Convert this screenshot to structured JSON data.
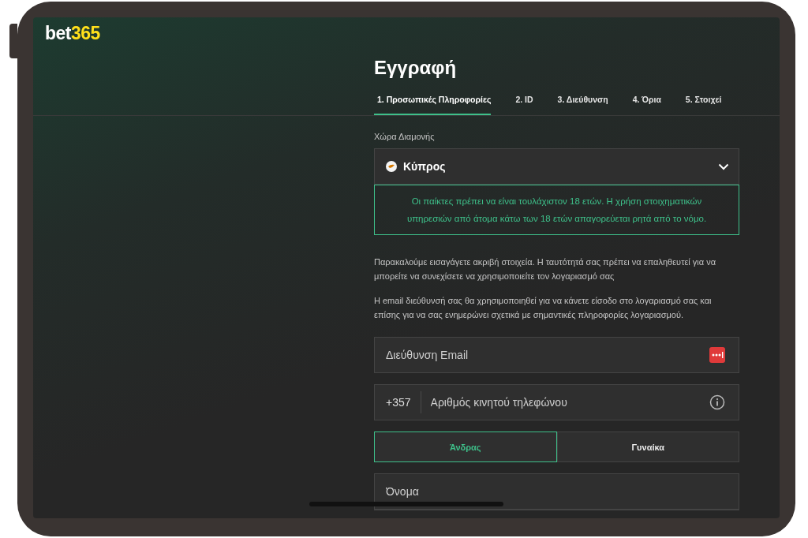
{
  "logo": {
    "part_1": "bet",
    "part_2": "365"
  },
  "title": "Εγγραφή",
  "tabs": [
    {
      "label": "1. Προσωπικές Πληροφορίες",
      "selected": true
    },
    {
      "label": "2. ID",
      "selected": false
    },
    {
      "label": "3. Διεύθυνση",
      "selected": false
    },
    {
      "label": "4. Όρια",
      "selected": false
    },
    {
      "label": "5. Στοιχεί",
      "selected": false
    }
  ],
  "country": {
    "label": "Χώρα Διαμονής",
    "value": "Κύπρος"
  },
  "notice": "Οι παίκτες πρέπει να είναι τουλάχιστον 18 ετών. Η χρήση στοιχηματικών υπηρεσιών από άτομα κάτω των 18 ετών απαγορεύεται ρητά από το νόμο.",
  "paragraphs": [
    "Παρακαλούμε εισαγάγετε ακριβή στοιχεία. Η ταυτότητά σας πρέπει να επαληθευτεί για να μπορείτε να συνεχίσετε να χρησιμοποιείτε τον λογαριασμό σας",
    "Η email διεύθυνσή σας θα χρησιμοποιηθεί για να κάνετε είσοδο στο λογαριασμό σας και επίσης για να σας ενημερώνει σχετικά με σημαντικές πληροφορίες λογαριασμού."
  ],
  "email": {
    "placeholder": "Διεύθυνση Email"
  },
  "phone": {
    "prefix": "+357",
    "placeholder": "Αριθμός κινητού τηλεφώνου"
  },
  "gender": [
    {
      "label": "Άνδρας",
      "selected": true
    },
    {
      "label": "Γυναίκα",
      "selected": false
    }
  ],
  "first_name": {
    "placeholder": "Όνομα"
  }
}
